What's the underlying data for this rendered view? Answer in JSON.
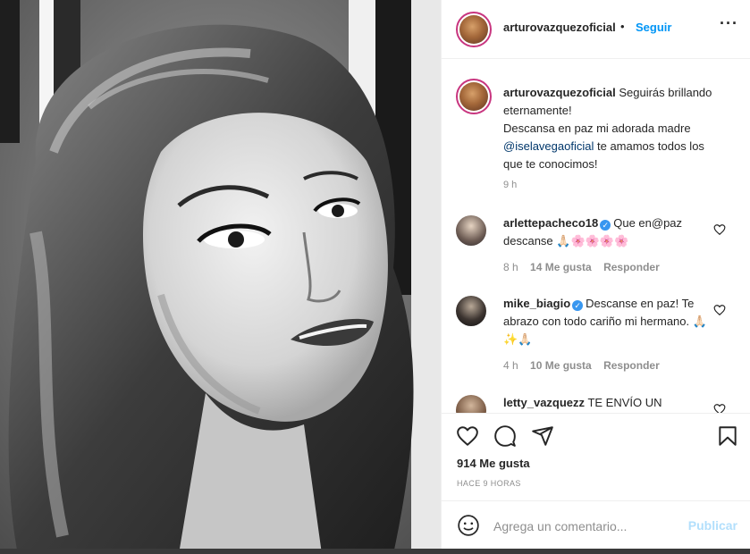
{
  "post": {
    "author": "arturovazquezoficial",
    "separator": "•",
    "follow_label": "Seguir",
    "more_icon": "more-horizontal-icon",
    "caption_line1": "Seguirás brillando eternamente!",
    "caption_line2": "Descansa en paz mi adorada madre",
    "caption_mention": "@iselavegaoficial",
    "caption_line3": "te amamos todos los que te conocimos!",
    "caption_time": "9 h"
  },
  "comments": [
    {
      "user": "arlettepacheco18",
      "verified": true,
      "text": "Que en@paz descanse 🙏🏻🌸🌸🌸🌸",
      "time": "8 h",
      "likes": "14 Me gusta",
      "reply": "Responder"
    },
    {
      "user": "mike_biagio",
      "verified": true,
      "text": "Descanse en paz! Te abrazo con todo cariño mi hermano. 🙏🏻✨🙏🏻",
      "time": "4 h",
      "likes": "10 Me gusta",
      "reply": "Responder"
    },
    {
      "user": "letty_vazquezz",
      "verified": false,
      "text": "TE ENVÍO UN",
      "time": "",
      "likes": "",
      "reply": ""
    }
  ],
  "actions": {
    "likes_count": "914 Me gusta",
    "posted_ago": "HACE 9 HORAS"
  },
  "composer": {
    "placeholder": "Agrega un comentario...",
    "post_label": "Publicar"
  },
  "colors": {
    "link": "#0095f6",
    "mention": "#00376b",
    "muted": "#8e8e8e",
    "verified": "#3897f0",
    "post_disabled": "#b2dffc"
  }
}
